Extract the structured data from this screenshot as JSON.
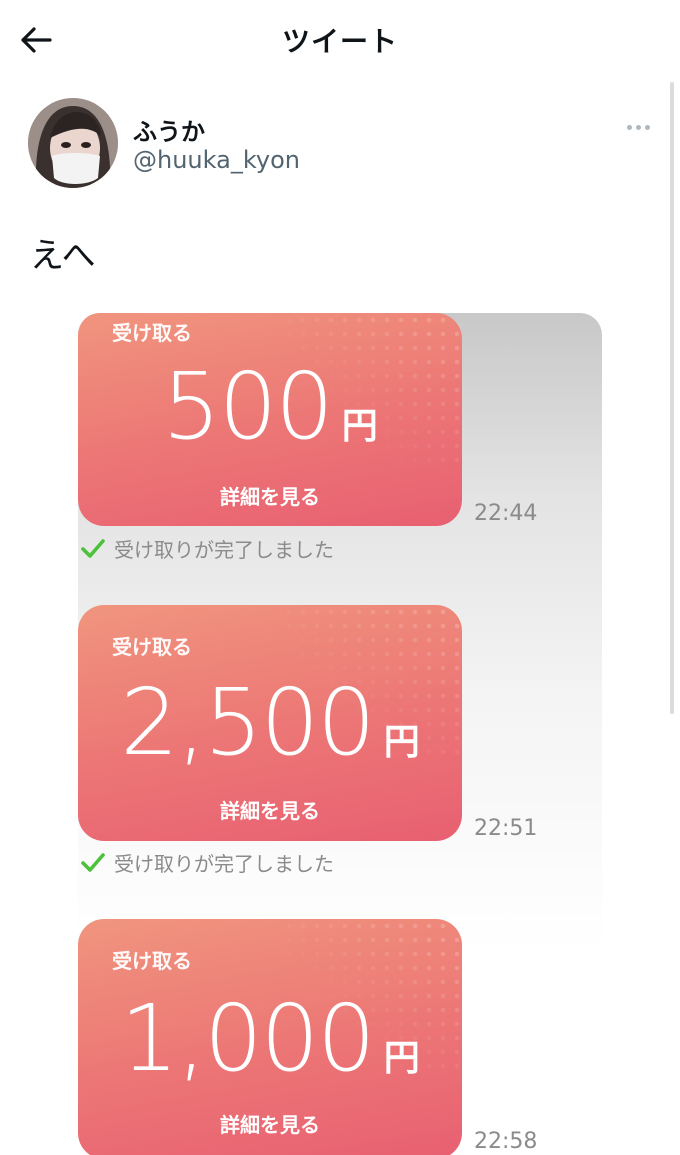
{
  "header": {
    "title": "ツイート",
    "back_icon": "arrow-left-icon"
  },
  "user": {
    "name": "ふうか",
    "handle": "@huuka_kyon"
  },
  "tweet": {
    "text": "えへ"
  },
  "payments": [
    {
      "label": "受け取る",
      "amount": "500",
      "currency": "円",
      "detail": "詳細を見る",
      "time": "22:44",
      "status": "受け取りが完了しました"
    },
    {
      "label": "受け取る",
      "amount": "2,500",
      "currency": "円",
      "detail": "詳細を見る",
      "time": "22:51",
      "status": "受け取りが完了しました"
    },
    {
      "label": "受け取る",
      "amount": "1,000",
      "currency": "円",
      "detail": "詳細を見る",
      "time": "22:58"
    }
  ],
  "colors": {
    "card_start": "#f0957e",
    "card_end": "#e86072",
    "check": "#4cc23a",
    "muted": "#8b8b8b"
  }
}
